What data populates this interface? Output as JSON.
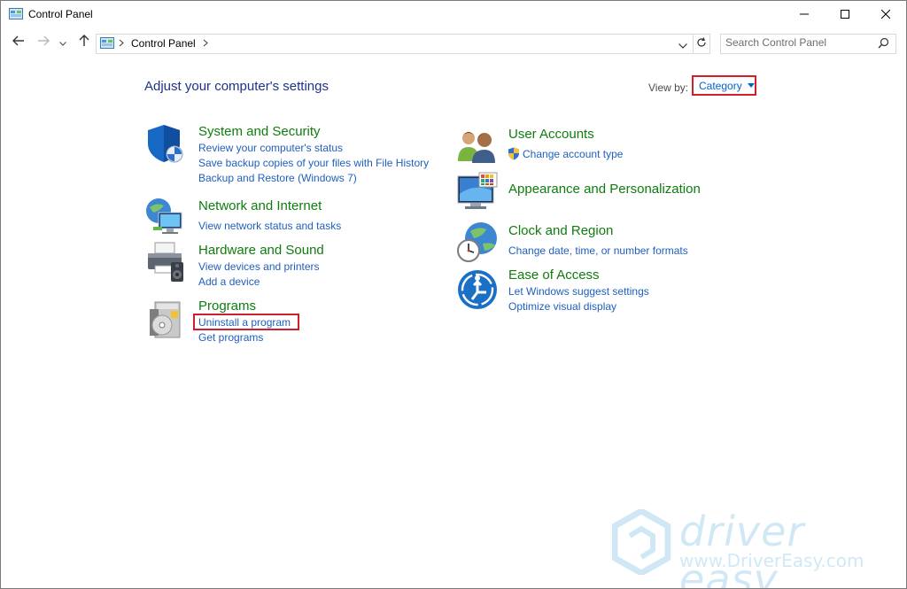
{
  "window": {
    "title": "Control Panel",
    "minimize_icon": "minimize-icon",
    "maximize_icon": "maximize-icon",
    "close_icon": "close-icon"
  },
  "nav": {
    "address_path": "Control Panel",
    "search_placeholder": "Search Control Panel"
  },
  "content": {
    "heading": "Adjust your computer's settings",
    "view_by_label": "View by:",
    "view_by_value": "Category"
  },
  "categories": [
    {
      "title": "System and Security",
      "icon": "shield-icon",
      "links": [
        "Review your computer's status",
        "Save backup copies of your files with File History",
        "Backup and Restore (Windows 7)"
      ]
    },
    {
      "title": "Network and Internet",
      "icon": "network-globe-icon",
      "links": [
        "View network status and tasks"
      ]
    },
    {
      "title": "Hardware and Sound",
      "icon": "printer-speaker-icon",
      "links": [
        "View devices and printers",
        "Add a device"
      ]
    },
    {
      "title": "Programs",
      "icon": "programs-disc-icon",
      "links": [
        "Uninstall a program",
        "Get programs"
      ]
    },
    {
      "title": "User Accounts",
      "icon": "users-icon",
      "links": [
        "Change account type"
      ]
    },
    {
      "title": "Appearance and Personalization",
      "icon": "monitor-palette-icon",
      "links": []
    },
    {
      "title": "Clock and Region",
      "icon": "clock-globe-icon",
      "links": [
        "Change date, time, or number formats"
      ]
    },
    {
      "title": "Ease of Access",
      "icon": "ease-of-access-icon",
      "links": [
        "Let Windows suggest settings",
        "Optimize visual display"
      ]
    }
  ],
  "watermark": {
    "line1": "driver easy",
    "line2": "www.DriverEasy.com"
  },
  "colors": {
    "category_title": "#0e7d0e",
    "link": "#1f5fbf",
    "heading": "#1e3287",
    "highlight": "#d01f2a"
  }
}
